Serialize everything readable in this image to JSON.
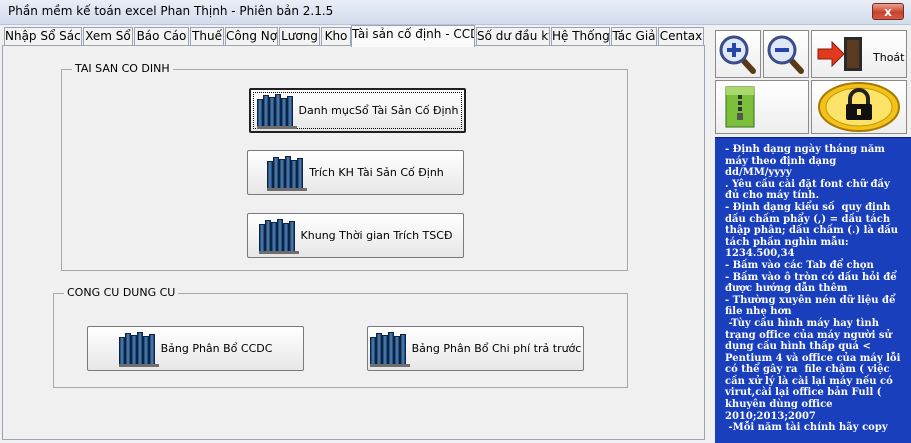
{
  "window": {
    "title": "Phần mềm kế toán excel Phan Thịnh  - Phiên bản 2.1.5",
    "close_label": "x"
  },
  "tabs": [
    {
      "label": "Nhập Sổ Sách"
    },
    {
      "label": "Xem Sổ"
    },
    {
      "label": "Báo Cáo"
    },
    {
      "label": "Thuế"
    },
    {
      "label": "Công Nợ"
    },
    {
      "label": "Lương"
    },
    {
      "label": "Kho"
    },
    {
      "label": "Tài sản cố định - CCDC",
      "active": true
    },
    {
      "label": "Số dư đầu kỳ"
    },
    {
      "label": "Hệ Thống"
    },
    {
      "label": "Tác Giả"
    },
    {
      "label": "Centax"
    }
  ],
  "fixed_assets": {
    "title": "TAI SAN CO DINH",
    "buttons": [
      {
        "label": "Danh mụcSổ Tài Sản Cố Định"
      },
      {
        "label": "Trích KH Tài Sản Cố Định"
      },
      {
        "label": "Khung Thời gian Trích TSCĐ"
      }
    ]
  },
  "tools": {
    "title": "CONG CU DUNG CU",
    "buttons": [
      {
        "label": "Bảng Phân Bổ CCDC"
      },
      {
        "label": "Bảng Phân Bổ Chi phí trả trước"
      }
    ]
  },
  "sidebar": {
    "exit_label": "Thoát",
    "info_lines": [
      "- Định dạng ngày tháng năm máy theo định dạng        dd/MM/yyyy",
      ". Yêu cầu cài đặt font chữ đầy đủ cho máy tính.",
      "- Định dạng kiểu số  quy định dấu chấm phẩy (,) = dấu tách thập phân; dấu chấm (.) là dấu tách phần nghìn mẫu: 1234.500,34",
      "- Bấm vào các Tab để chọn",
      "- Bấm vào ô tròn có dấu hỏi để được hướng dẫn thêm",
      "- Thường xuyên nén dữ liệu để file nhẹ hơn",
      " -Tùy cấu hình máy hay tình trạng office của máy người sử dụng cấu hình thấp quá < Pentium 4 và office của máy lỗi có thể gây ra  file chậm ( việc cần xử lý là cài lại máy nếu có virut,cài lại office bản Full ( khuyên dùng office 2010;2013;2007",
      " -Mỗi năm tài chính hãy copy"
    ]
  },
  "colors": {
    "info_bg": "#1a3fbd",
    "info_text": "#ffffff",
    "close_bg": "#c9412a"
  }
}
